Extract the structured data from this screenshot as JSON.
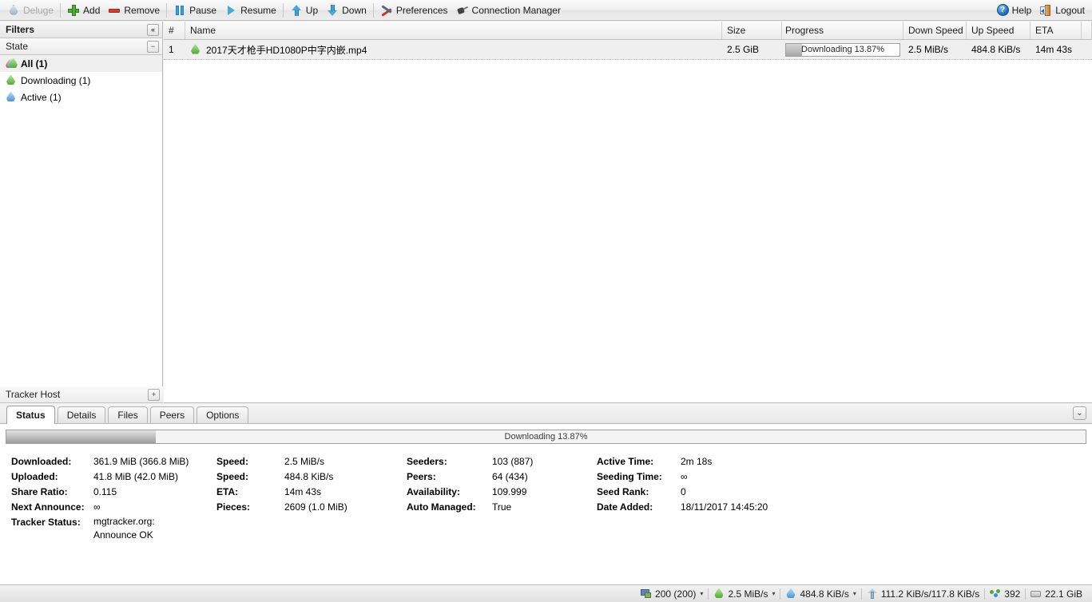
{
  "toolbar": {
    "app_label": "Deluge",
    "buttons": [
      {
        "label": "Add",
        "icon": "plus-icon"
      },
      {
        "label": "Remove",
        "icon": "minus-icon"
      },
      {
        "label": "Pause",
        "icon": "pause-icon"
      },
      {
        "label": "Resume",
        "icon": "play-icon"
      },
      {
        "label": "Up",
        "icon": "arrow-up-icon"
      },
      {
        "label": "Down",
        "icon": "arrow-down-icon"
      },
      {
        "label": "Preferences",
        "icon": "wrench-icon"
      },
      {
        "label": "Connection Manager",
        "icon": "plug-icon"
      }
    ],
    "help_label": "Help",
    "help_glyph": "?",
    "logout_label": "Logout"
  },
  "sidebar": {
    "title": "Filters",
    "collapse_glyph": "«",
    "state_group": {
      "title": "State",
      "collapse_glyph": "−",
      "items": [
        {
          "label": "All (1)",
          "icon": "all-drop-icon",
          "selected": true
        },
        {
          "label": "Downloading (1)",
          "icon": "download-drop-icon",
          "selected": false
        },
        {
          "label": "Active (1)",
          "icon": "active-drop-icon",
          "selected": false
        }
      ]
    },
    "tracker_host": {
      "title": "Tracker Host",
      "expand_glyph": "+"
    }
  },
  "grid": {
    "columns": [
      {
        "label": "#",
        "key": "num"
      },
      {
        "label": "Name",
        "key": "name"
      },
      {
        "label": "Size",
        "key": "size"
      },
      {
        "label": "Progress",
        "key": "progress"
      },
      {
        "label": "Down Speed",
        "key": "down"
      },
      {
        "label": "Up Speed",
        "key": "up"
      },
      {
        "label": "ETA",
        "key": "eta"
      }
    ],
    "rows": [
      {
        "num": "1",
        "name": "2017天才枪手HD1080P中字内嵌.mp4",
        "size": "2.5 GiB",
        "progress_label": "Downloading 13.87%",
        "progress_percent": 13.87,
        "down": "2.5 MiB/s",
        "up": "484.8 KiB/s",
        "eta": "14m 43s"
      }
    ]
  },
  "details": {
    "tabs": [
      {
        "label": "Status",
        "active": true
      },
      {
        "label": "Details",
        "active": false
      },
      {
        "label": "Files",
        "active": false
      },
      {
        "label": "Peers",
        "active": false
      },
      {
        "label": "Options",
        "active": false
      }
    ],
    "collapse_glyph": "⌄",
    "progress": {
      "label": "Downloading 13.87%",
      "percent": 13.87
    },
    "stats": {
      "col1": [
        {
          "key": "Downloaded:",
          "value": "361.9 MiB (366.8 MiB)"
        },
        {
          "key": "Uploaded:",
          "value": "41.8 MiB (42.0 MiB)"
        },
        {
          "key": "Share Ratio:",
          "value": "0.115"
        },
        {
          "key": "Next Announce:",
          "value": "∞"
        },
        {
          "key": "Tracker Status:",
          "value": "mgtracker.org: Announce OK"
        }
      ],
      "col2": [
        {
          "key": "Speed:",
          "value": "2.5 MiB/s"
        },
        {
          "key": "Speed:",
          "value": "484.8 KiB/s"
        },
        {
          "key": "ETA:",
          "value": "14m 43s"
        },
        {
          "key": "Pieces:",
          "value": "2609 (1.0 MiB)"
        }
      ],
      "col3": [
        {
          "key": "Seeders:",
          "value": "103 (887)"
        },
        {
          "key": "Peers:",
          "value": "64 (434)"
        },
        {
          "key": "Availability:",
          "value": "109.999"
        },
        {
          "key": "Auto Managed:",
          "value": "True"
        }
      ],
      "col4": [
        {
          "key": "Active Time:",
          "value": "2m 18s"
        },
        {
          "key": "Seeding Time:",
          "value": "∞"
        },
        {
          "key": "Seed Rank:",
          "value": "0"
        },
        {
          "key": "Date Added:",
          "value": "18/11/2017 14:45:20"
        }
      ]
    }
  },
  "statusbar": {
    "connections": {
      "value": "200 (200)",
      "icon": "connections-icon",
      "caret": "▾"
    },
    "download_speed": {
      "value": "2.5 MiB/s",
      "icon": "download-drop-icon",
      "caret": "▾"
    },
    "upload_speed": {
      "value": "484.8 KiB/s",
      "icon": "upload-drop-icon",
      "caret": "▾"
    },
    "protocol_traffic": {
      "value": "111.2 KiB/s/117.8 KiB/s",
      "icon": "protocol-icon"
    },
    "peers": {
      "value": "392",
      "icon": "peers-icon"
    },
    "free_space": {
      "value": "22.1 GiB",
      "icon": "disk-icon"
    }
  },
  "colors": {
    "accent_green": "#4ea52f",
    "accent_blue": "#3f8fd0",
    "toolbar_bg": "#efefef",
    "row_bg": "#efefef"
  }
}
